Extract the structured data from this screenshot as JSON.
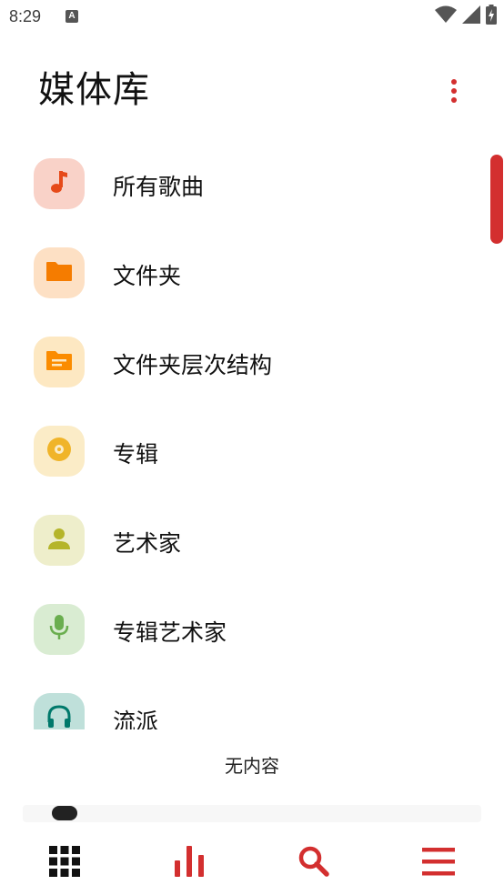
{
  "status_bar": {
    "time": "8:29",
    "notification": "A"
  },
  "header": {
    "title": "媒体库",
    "menu_icon": "more-vert-icon"
  },
  "library": {
    "items": [
      {
        "label": "所有歌曲",
        "icon": "music-note-icon",
        "bg": "#f9d2c8",
        "fg": "#e64a19"
      },
      {
        "label": "文件夹",
        "icon": "folder-icon",
        "bg": "#fde0c4",
        "fg": "#f57c00"
      },
      {
        "label": "文件夹层次结构",
        "icon": "folder-tree-icon",
        "bg": "#fde8c2",
        "fg": "#fb8c00"
      },
      {
        "label": "专辑",
        "icon": "album-icon",
        "bg": "#fbecc7",
        "fg": "#f0b429"
      },
      {
        "label": "艺术家",
        "icon": "person-icon",
        "bg": "#eeeecb",
        "fg": "#b5b52a"
      },
      {
        "label": "专辑艺术家",
        "icon": "mic-icon",
        "bg": "#d9ecd2",
        "fg": "#6aae4f"
      },
      {
        "label": "流派",
        "icon": "headphones-icon",
        "bg": "#bfe0da",
        "fg": "#00796b"
      }
    ]
  },
  "empty_state": {
    "text": "无内容"
  },
  "bottom_nav": {
    "items": [
      {
        "name": "library",
        "icon": "grid-icon"
      },
      {
        "name": "charts",
        "icon": "bar-chart-icon"
      },
      {
        "name": "search",
        "icon": "search-icon"
      },
      {
        "name": "menu",
        "icon": "hamburger-menu-icon"
      }
    ]
  },
  "colors": {
    "accent": "#d32f2f",
    "nav_dark": "#111111"
  }
}
